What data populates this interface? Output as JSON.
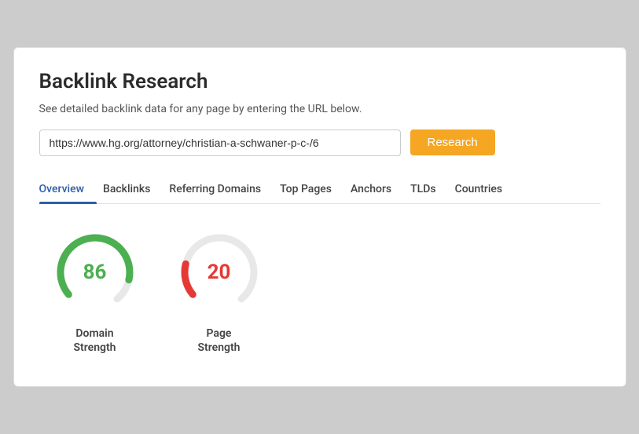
{
  "page": {
    "title": "Backlink Research",
    "subtitle": "See detailed backlink data for any page by entering the URL below."
  },
  "search": {
    "value": "https://www.hg.org/attorney/christian-a-schwaner-p-c-/6",
    "placeholder": "Enter URL",
    "button_label": "Research"
  },
  "tabs": [
    {
      "id": "overview",
      "label": "Overview",
      "active": true
    },
    {
      "id": "backlinks",
      "label": "Backlinks",
      "active": false
    },
    {
      "id": "referring-domains",
      "label": "Referring Domains",
      "active": false
    },
    {
      "id": "top-pages",
      "label": "Top Pages",
      "active": false
    },
    {
      "id": "anchors",
      "label": "Anchors",
      "active": false
    },
    {
      "id": "tlds",
      "label": "TLDs",
      "active": false
    },
    {
      "id": "countries",
      "label": "Countries",
      "active": false
    }
  ],
  "metrics": [
    {
      "id": "domain-strength",
      "value": 86,
      "label": "Domain\nStrength",
      "type": "green",
      "percent": 86,
      "track_color": "#e8e8e8",
      "fill_color": "#4caf50"
    },
    {
      "id": "page-strength",
      "value": 20,
      "label": "Page\nStrength",
      "type": "red",
      "percent": 20,
      "track_color": "#e8e8e8",
      "fill_color": "#e53935"
    }
  ],
  "colors": {
    "accent_blue": "#2c5fa8",
    "button_orange": "#f5a623",
    "green": "#4caf50",
    "red": "#e53935",
    "track": "#e8e8e8"
  }
}
